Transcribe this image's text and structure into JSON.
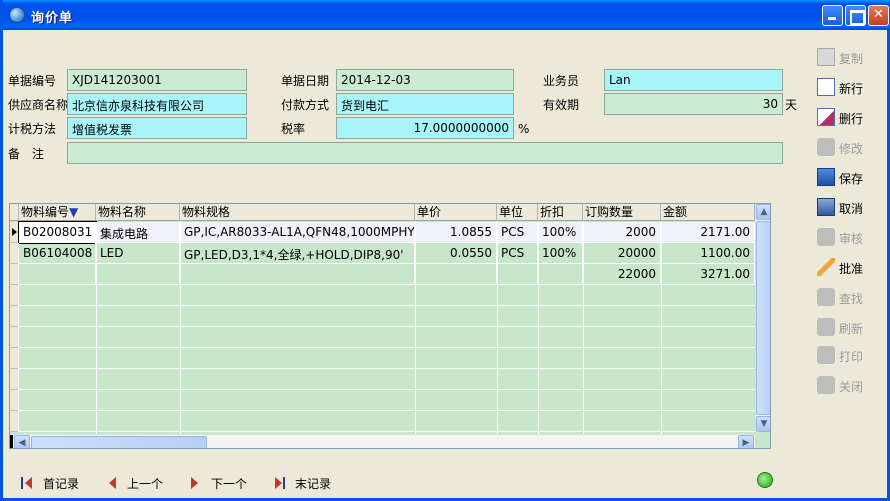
{
  "window": {
    "title": "询价单"
  },
  "form": {
    "doc_no_label": "单据编号",
    "doc_no": "XJD141203001",
    "doc_date_label": "单据日期",
    "doc_date": "2014-12-03",
    "salesman_label": "业务员",
    "salesman": "Lan",
    "supplier_label": "供应商名称",
    "supplier": "北京信亦泉科技有限公司",
    "payment_label": "付款方式",
    "payment": "货到电汇",
    "validity_label": "有效期",
    "validity": "30",
    "validity_unit": "天",
    "tax_method_label": "计税方法",
    "tax_method": "增值税发票",
    "tax_rate_label": "税率",
    "tax_rate": "17.0000000000",
    "tax_rate_unit": "%",
    "remark_label": "备　注",
    "remark": ""
  },
  "sidebar": {
    "copy": "复制",
    "new_row": "新行",
    "delete_row": "删行",
    "edit": "修改",
    "save": "保存",
    "cancel": "取消",
    "audit": "审核",
    "approve": "批准",
    "find": "查找",
    "refresh": "刷新",
    "print": "打印",
    "close": "关闭"
  },
  "grid": {
    "headers": [
      "物料编号",
      "物料名称",
      "物料规格",
      "单价",
      "单位",
      "折扣",
      "订购数量",
      "金额"
    ],
    "sort_indicator": "▼",
    "rows": [
      {
        "code": "B02008031",
        "name": "集成电路",
        "spec": "GP,IC,AR8033-AL1A,QFN48,1000MPHY",
        "price": "1.0855",
        "unit": "PCS",
        "discount": "100%",
        "qty": "2000",
        "amount": "2171.00"
      },
      {
        "code": "B06104008",
        "name": "LED",
        "spec": "GP,LED,D3,1*4,全绿,+HOLD,DIP8,90'",
        "price": "0.0550",
        "unit": "PCS",
        "discount": "100%",
        "qty": "20000",
        "amount": "1100.00"
      }
    ],
    "totals": {
      "qty": "22000",
      "amount": "3271.00"
    }
  },
  "nav": {
    "first": "首记录",
    "prev": "上一个",
    "next": "下一个",
    "last": "末记录"
  }
}
